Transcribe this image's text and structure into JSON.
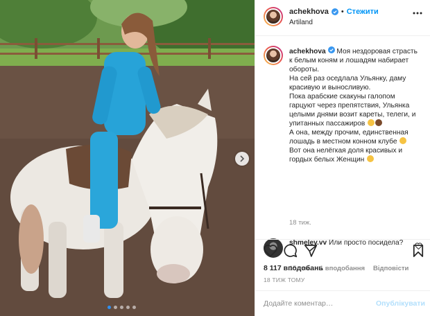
{
  "header": {
    "username": "achekhova",
    "separator": "•",
    "follow_label": "Стежити",
    "location": "Artiland"
  },
  "caption": {
    "username": "achekhova",
    "text": "Моя нездоровая страсть к белым коням и лошадям набирает обороты.",
    "line2": "На сей раз оседлала Ульянку, даму красивую и выносливую.",
    "line3": "Пока арабские скакуны галопом гарцуют через препятствия, Ульянка целыми днями возит кареты, телеги, и упитанных пассажиров",
    "line4": "А она, между прочим, единственная лошадь в местном конном клубе",
    "line5": "Вот она нелёгкая доля красивых и гордых белых Женщин",
    "time": "18 тиж."
  },
  "reply": {
    "username": "shmelev.vv",
    "text": "Или просто посидела?",
    "time": "15 тиж.",
    "likes": "1 вподобання",
    "reply_label": "Відповісти"
  },
  "actions": {
    "likes_count": "8 117 вподобань",
    "date": "18 ТИЖ ТОМУ"
  },
  "add_comment": {
    "placeholder": "Додайте коментар…",
    "post_label": "Опублікувати"
  },
  "carousel": {
    "slides": 5,
    "active_index": 0
  },
  "colors": {
    "accent": "#0095f6",
    "verified": "#3897f0",
    "post_disabled": "#b2dffc"
  },
  "icons": [
    "more-icon",
    "verified-icon",
    "heart-icon",
    "comment-icon",
    "share-icon",
    "bookmark-icon",
    "next-arrow-icon"
  ]
}
